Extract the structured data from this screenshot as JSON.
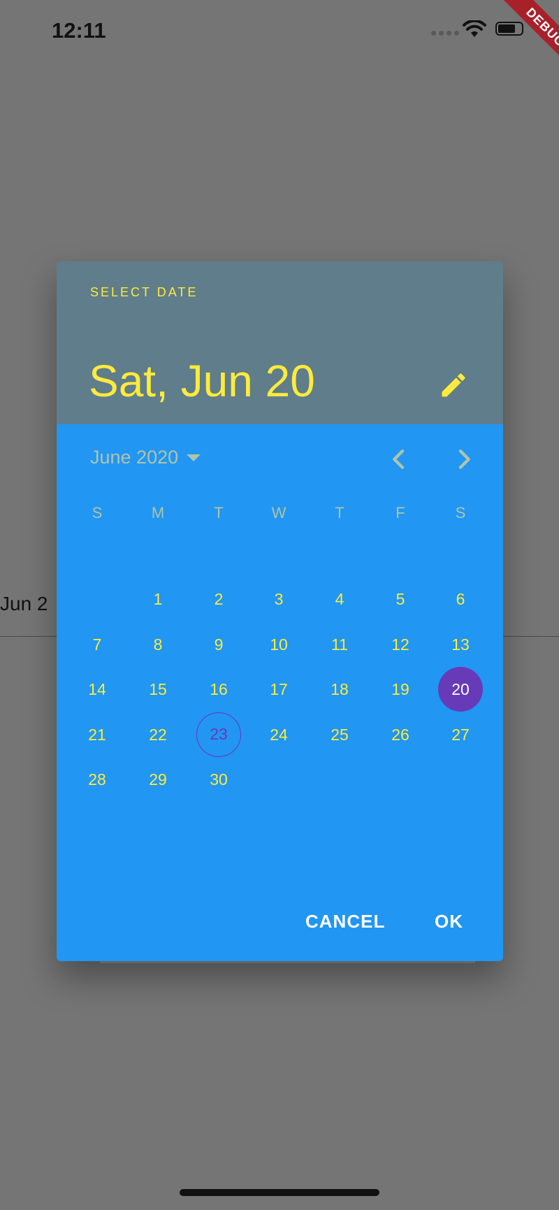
{
  "status_bar": {
    "time": "12:11"
  },
  "debug_banner": "DEBUG",
  "background": {
    "date_field_text": "Jun 2"
  },
  "dialog": {
    "header_label": "SELECT DATE",
    "selected_date": "Sat, Jun 20",
    "edit_icon": "pencil-icon",
    "month_label": "June 2020",
    "weekdays": [
      "S",
      "M",
      "T",
      "W",
      "T",
      "F",
      "S"
    ],
    "first_weekday_offset": 1,
    "days": [
      "1",
      "2",
      "3",
      "4",
      "5",
      "6",
      "7",
      "8",
      "9",
      "10",
      "11",
      "12",
      "13",
      "14",
      "15",
      "16",
      "17",
      "18",
      "19",
      "20",
      "21",
      "22",
      "23",
      "24",
      "25",
      "26",
      "27",
      "28",
      "29",
      "30"
    ],
    "selected_day": "20",
    "today_day": "23",
    "cancel_label": "CANCEL",
    "ok_label": "OK"
  },
  "colors": {
    "header_bg": "#607d8b",
    "body_bg": "#2196f3",
    "accent_text": "#ffeb3b",
    "muted_text": "#b0c4a8",
    "selected_bg": "#673ab7",
    "scrim": "#757575"
  }
}
